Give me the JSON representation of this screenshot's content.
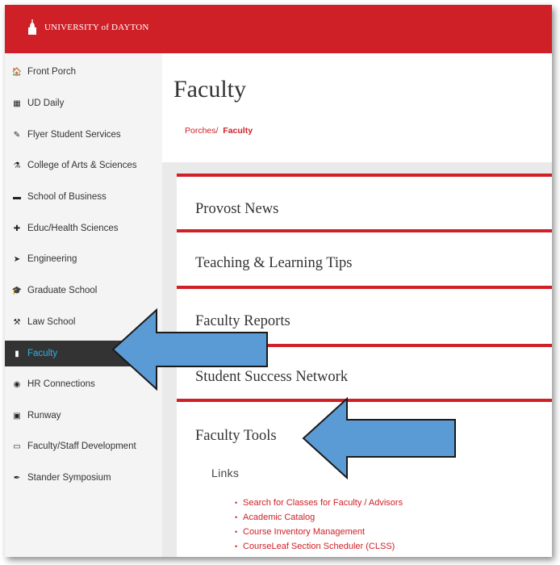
{
  "header": {
    "brand": "UNIVERSITY of DAYTON"
  },
  "sidebar": {
    "items": [
      {
        "label": "Front Porch",
        "icon": "home-icon",
        "glyph": "🏠"
      },
      {
        "label": "UD Daily",
        "icon": "calendar-icon",
        "glyph": "▦"
      },
      {
        "label": "Flyer Student Services",
        "icon": "feather-icon",
        "glyph": "✎"
      },
      {
        "label": "College of Arts & Sciences",
        "icon": "flask-icon",
        "glyph": "⚗"
      },
      {
        "label": "School of Business",
        "icon": "briefcase-icon",
        "glyph": "▬"
      },
      {
        "label": "Educ/Health Sciences",
        "icon": "plus-icon",
        "glyph": "✚"
      },
      {
        "label": "Engineering",
        "icon": "rocket-icon",
        "glyph": "➤"
      },
      {
        "label": "Graduate School",
        "icon": "graduation-cap-icon",
        "glyph": "🎓"
      },
      {
        "label": "Law School",
        "icon": "gavel-icon",
        "glyph": "⚒"
      },
      {
        "label": "Faculty",
        "icon": "book-icon",
        "glyph": "▮"
      },
      {
        "label": "HR Connections",
        "icon": "eye-icon",
        "glyph": "◉"
      },
      {
        "label": "Runway",
        "icon": "camera-icon",
        "glyph": "▣"
      },
      {
        "label": "Faculty/Staff Development",
        "icon": "laptop-icon",
        "glyph": "▭"
      },
      {
        "label": "Stander Symposium",
        "icon": "pen-icon",
        "glyph": "✒"
      }
    ],
    "active_index": 9
  },
  "main": {
    "title": "Faculty",
    "breadcrumb": {
      "parent": "Porches/",
      "current": "Faculty"
    },
    "sections": [
      {
        "title": "Provost News"
      },
      {
        "title": "Teaching & Learning Tips"
      },
      {
        "title": "Faculty Reports"
      },
      {
        "title": "Student Success Network"
      },
      {
        "title": "Faculty Tools"
      }
    ],
    "links_heading": "Links",
    "links": [
      "Search for Classes for Faculty / Advisors",
      "Academic Catalog",
      "Course Inventory Management",
      "CourseLeaf Section Scheduler (CLSS)"
    ]
  },
  "colors": {
    "brand_red": "#cf2027",
    "active_text": "#2fb3e6",
    "arrow_blue": "#5b9bd5"
  }
}
